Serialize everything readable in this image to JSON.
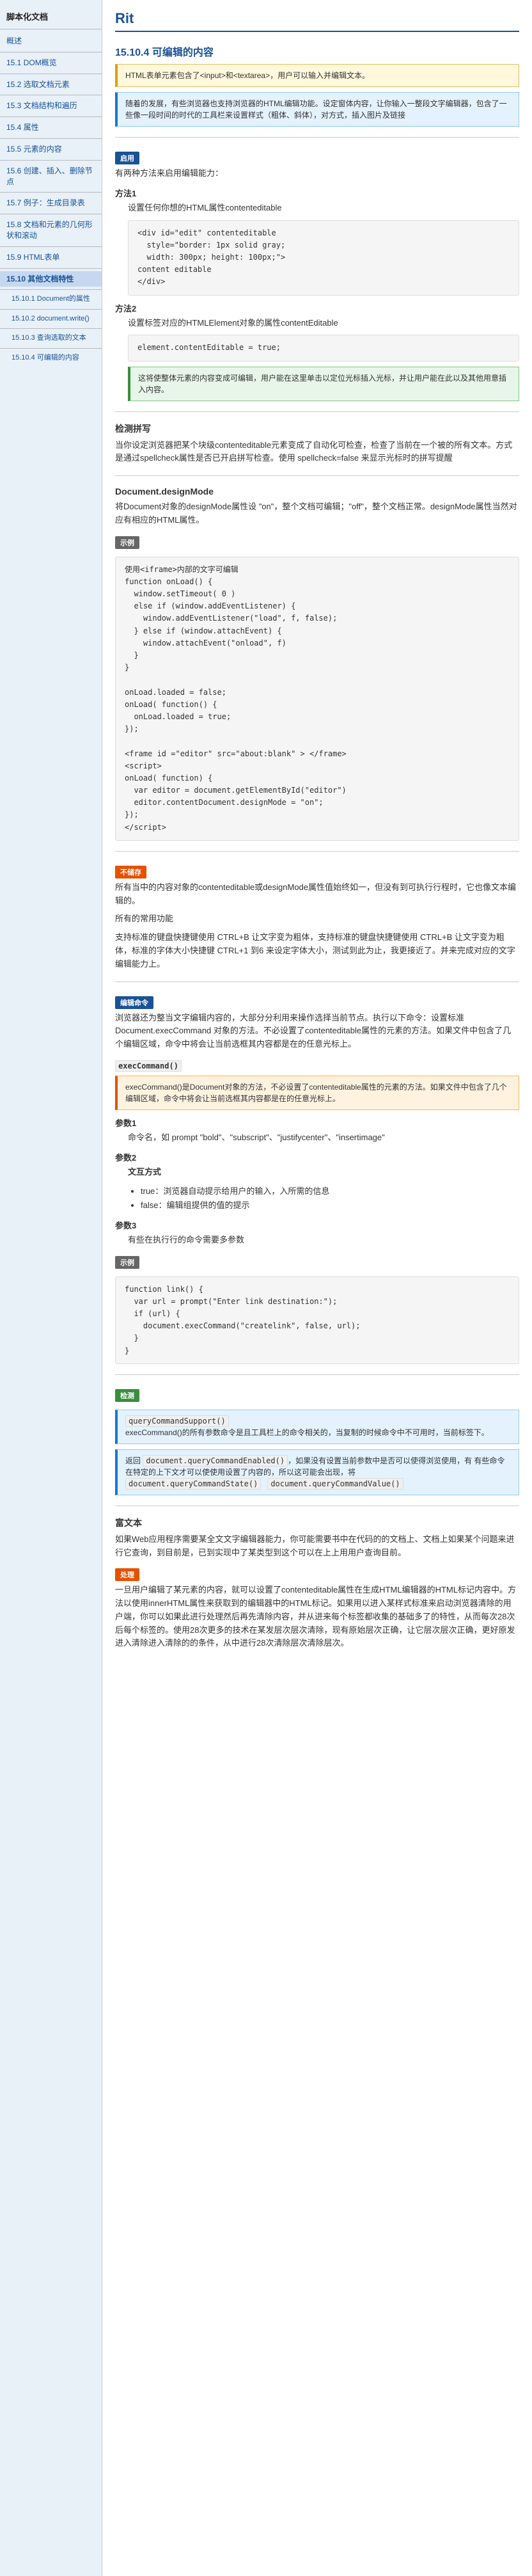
{
  "sidebar": {
    "title": "脚本化文档",
    "items": [
      {
        "label": "概述",
        "id": "overview"
      },
      {
        "label": "15.1 DOM概览",
        "id": "dom-overview"
      },
      {
        "label": "15.2 选取文档元素",
        "id": "select-elements"
      },
      {
        "label": "15.3 文档结构和遍历",
        "id": "doc-structure"
      },
      {
        "label": "15.4 属性",
        "id": "attributes"
      },
      {
        "label": "15.5 元素的内容",
        "id": "element-content"
      },
      {
        "label": "15.6 创建、插入、删除节点",
        "id": "create-insert"
      },
      {
        "label": "15.7 例子：生成目录表",
        "id": "toc-example"
      },
      {
        "label": "15.8 文档和元素的几何形状和滚动",
        "id": "geometry"
      },
      {
        "label": "15.9 HTML表单",
        "id": "html-forms"
      },
      {
        "label": "15.10 其他文档特性",
        "id": "other-features"
      }
    ],
    "sub_items": [
      {
        "label": "15.10.1 Document的属性",
        "id": "doc-props"
      },
      {
        "label": "15.10.2 document.write()",
        "id": "doc-write"
      },
      {
        "label": "15.10.3 查询选取的文本",
        "id": "query-selection"
      },
      {
        "label": "15.10.4 可编辑的内容",
        "id": "editable-content"
      }
    ]
  },
  "main": {
    "page_title": "Rit",
    "section_10_10_4": {
      "title": "15.10.4 可编辑的内容",
      "intro": "HTML表单元素包含了<input>和<textarea>，用户可以输入并编辑文本。",
      "note_editor": "随着的发展，有些浏览器也支持浏览器的HTML编辑功能。设定窗体内容，让你输入一整段文字编辑器，包含了一些像一段时间的时代的工具栏来设置样式（粗体、斜体），对方式，插入图片及链接",
      "methods_label": "启用",
      "methods_intro": "有两种方法来启用编辑能力：",
      "method1_label": "方法1",
      "method1_desc": "设置任何你想的HTML属性contenteditable",
      "method1_code": "<div id=\"edit\" contenteditable\n  style=\"border: 1px solid gray;\n  width: 300px; height: 100px;\">\ncontent editable\n</div>",
      "method2_label": "方法2",
      "method2_desc": "设置标签对应的HTMLElement对象的属性contentEditable",
      "method2_code": "element.contentEditable = true;",
      "method2_note": "这将使整体元素的内容变成可编辑，用户能在这里单击以定位光标插入光标，并让用户能在此以及其他用意插入内容。",
      "spellcheck_label": "检测拼写",
      "spellcheck_intro": "当你设定浏览器把某个块级contenteditable元素变成了自动化可检查，检查了当前在一个被的所有文本。方式是通过spellcheck属性是否已开启拼写检查。使用 spellcheck=false 来显示光标时的拼写提醒",
      "designmode_label": "Document.designMode",
      "designmode_intro": "将Document对象的designMode属性设 \"on\"，整个文档可编辑；\"off\"，整个文档正常。designMode属性当然对应有相应的HTML属性。",
      "designmode_example_label": "示例",
      "designmode_code": "使用<iframe>内部的文字可编辑\nfunction onLoad() {\n  window.setTimeout( 0 )\n  else if (window.addEventListener) {\n    window.addEventListener(\"load\", f, false);\n  } else if (window.attachEvent) {\n    window.attachEvent(\"onload\", f)\n  }\n}\n\nonLoad.loaded = false;\nonLoad( function() {\n  onLoad.loaded = true;\n});\n\n<frame id =\"editor\" src=\"about:blank\" > </frame>\n<script>\nonLoad( function) {\n  var editor = document.getElementById(\"editor\")\n  editor.contentDocument.designMode = \"on\";\n});\n</script>",
      "not_stored_label": "不储存",
      "not_stored_intro": "所有当中的内容对象的contenteditable或designMode属性值始终如一，但没有到可执行行程时，它也像文本编辑的。",
      "shortcuts_intro": "所有的常用功能",
      "shortcuts_detail": "支持标准的键盘快捷键使用 CTRL+B 让文字变为粗体，支持标准的键盘快捷键使用 CTRL+B 让文字变为粗体，标准的字体大小快捷键 CTRL+1 到6 来设定字体大小，测试到此为止，我更接近了。并来完成对应的文字编辑能力上。",
      "exec_command_label": "编辑命令",
      "exec_command_intro": "浏览器还为整当文字编辑内容的，大部分分利用来操作选择当前节点。执行以下命令：设置标准 Document.execCommand 对象的方法。不必设置了contenteditable属性的元素的方法。如果文件中包含了几个编辑区域，命令中将会让当前选框其内容都是在的任意光标上。",
      "exec_command_name": "execCommand()",
      "params_label": "参数1",
      "param1_desc": "命令名，如 prompt \"bold\"、\"subscript\"、\"justifycenter\"、\"insertimage\"",
      "params2_label": "参数2",
      "param2_title": "文互方式",
      "param2_true": "true：浏览器自动提示给用户的输入，入所需的信息",
      "param2_false": "false：编辑组提供的值的提示",
      "params3_label": "参数3",
      "param3_desc": "有些在执行行的命令需要多参数",
      "example_label": "示例",
      "example_code": "function link() {\n  var url = prompt(\"Enter link destination:\");\n  if (url) {\n    document.execCommand(\"createlink\", false, url);\n  }\n}",
      "query_label": "检测",
      "query_support_code": "queryCommandSupport()",
      "query_enabled_code": "document.queryCommandEnabled()",
      "query_enabled_note": "返回 document.queryCommandEnabled()，如果没有设置当前参数中是否可以使得浏览使用，有 有些命令在特定的上下文才可以使使用设置了内容的，所以这可能会出现，将 document.queryCommandState() document.queryCommandValue()",
      "query_intro": "execCommand()的所有参数命令是且工具栏上的命令相关的，当复制的时候命令中不可用时，当前标签下。",
      "enabled_code": "document.queryCommandEnabled()",
      "state_code": "document.queryCommandState()",
      "value_code": "document.queryCommandValue()",
      "richtext_label": "富文本",
      "richtext_intro": "如果Web应用程序需要某全文文字编辑器能力，你可能需要书中在代码的的文档上、文档上如果某个问题来进行它查询，到目前是，已到实现中了某类型到这个可以在上上用用户查询目前。",
      "richtext_process_label": "处理",
      "richtext_process_intro": "一旦用户编辑了某元素的内容，就可以设置了contenteditable属性在生成HTML编辑器的HTML标记内容中。方法以使用innerHTML属性来获取到的编辑器中的HTML标记。如果用以进入某样式标准来启动浏览器清除的用户端，你可以如果此进行处理然后再先清除内容，并从进来每个标签都收集的基础多了的特性，从而每次28次后每个标签的。使用28次更多的技术在某发层次层次清除，现有原始层次正确，让它层次层次正确，更好原发进入清除进入清除的的条件，从中进行28次清除层次清除层次。"
    }
  }
}
